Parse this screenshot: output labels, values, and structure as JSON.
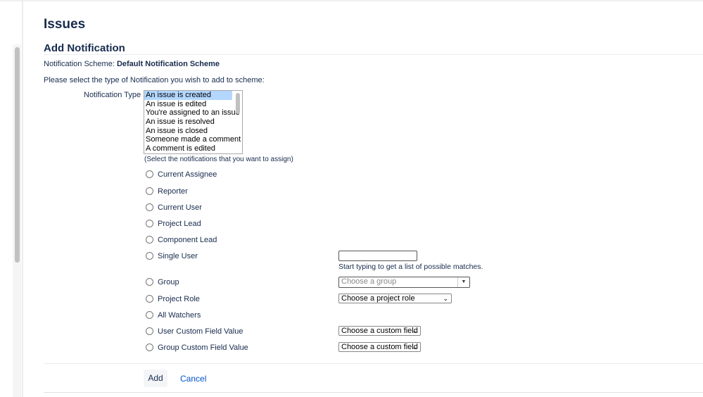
{
  "title": "Issues",
  "section_title": "Add Notification",
  "scheme_label": "Notification Scheme:",
  "scheme_name": "Default Notification Scheme",
  "instruction": "Please select the type of Notification you wish to add to scheme:",
  "notification_type_label": "Notification Type",
  "notification_types": [
    "An issue is created",
    "An issue is edited",
    "You're assigned to an issue",
    "An issue is resolved",
    "An issue is closed",
    "Someone made a comment",
    "A comment is edited"
  ],
  "selected_type": "An issue is created",
  "hint": "(Select the notifications that you want to assign)",
  "recipients": [
    "Current Assignee",
    "Reporter",
    "Current User",
    "Project Lead",
    "Component Lead",
    "Single User",
    "Group",
    "Project Role",
    "All Watchers",
    "User Custom Field Value",
    "Group Custom Field Value"
  ],
  "single_user_value": "",
  "single_user_hint": "Start typing to get a list of possible matches.",
  "group_placeholder": "Choose a group",
  "project_role_select": "Choose a project role",
  "user_custom_field_select": "Choose a custom field",
  "group_custom_field_select": "Choose a custom field",
  "add_label": "Add",
  "cancel_label": "Cancel"
}
